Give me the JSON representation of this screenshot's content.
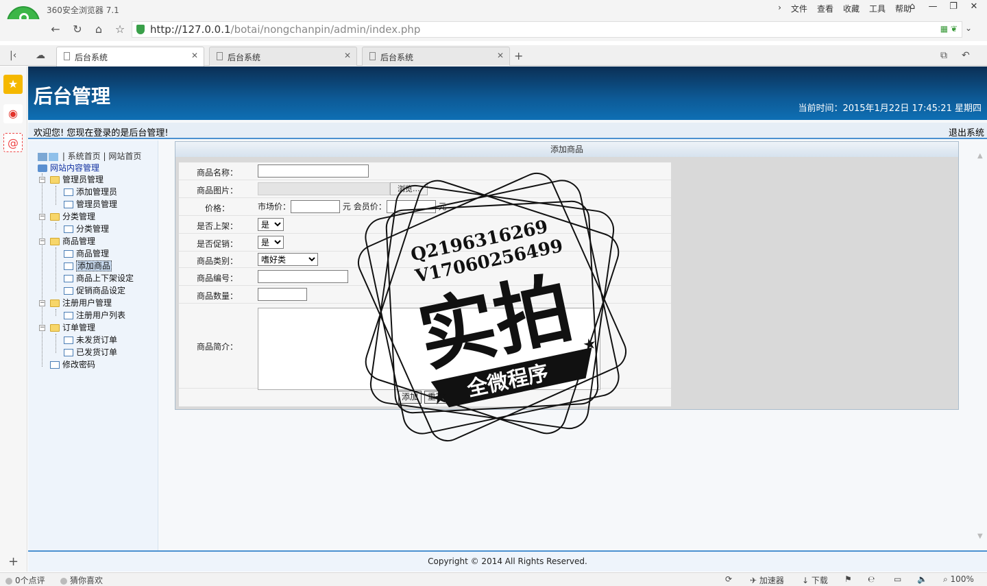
{
  "browser": {
    "app_title": "360安全浏览器 7.1",
    "menu": [
      "文件",
      "查看",
      "收藏",
      "工具",
      "帮助"
    ],
    "url_host": "http://127.0.0.1",
    "url_path": "/botai/nongchanpin/admin/index.php",
    "tabs": [
      {
        "label": "后台系统",
        "active": true
      },
      {
        "label": "后台系统",
        "active": false
      },
      {
        "label": "后台系统",
        "active": false
      }
    ],
    "status": {
      "comments": "0个点评",
      "guess": "猜你喜欢",
      "accelerator": "加速器",
      "download": "下载",
      "zoom": "100%"
    }
  },
  "header": {
    "title": "后台管理",
    "current_time": "当前时间：2015年1月22日 17:45:21 星期四",
    "welcome": "欢迎您! 您现在登录的是后台管理!",
    "logout": "退出系统"
  },
  "sidebar": {
    "top_links": "| 系统首页 | 网站首页",
    "root": "网站内容管理",
    "groups": [
      {
        "label": "管理员管理",
        "items": [
          "添加管理员",
          "管理员管理"
        ]
      },
      {
        "label": "分类管理",
        "items": [
          "分类管理"
        ]
      },
      {
        "label": "商品管理",
        "items": [
          "商品管理",
          "添加商品",
          "商品上下架设定",
          "促销商品设定"
        ]
      },
      {
        "label": "注册用户管理",
        "items": [
          "注册用户列表"
        ]
      },
      {
        "label": "订单管理",
        "items": [
          "未发货订单",
          "已发货订单"
        ]
      }
    ],
    "change_password": "修改密码",
    "selected": "添加商品"
  },
  "form": {
    "title": "添加商品",
    "name_label": "商品名称：",
    "image_label": "商品图片：",
    "browse_label": "浏览...",
    "price_label": "价格：",
    "market_price_label": "市场价：",
    "member_price_label": "会员价：",
    "yuan": "元",
    "on_shelf_label": "是否上架：",
    "on_shelf_value": "是",
    "promo_label": "是否促销：",
    "promo_value": "是",
    "category_label": "商品类别：",
    "category_value": "嗜好类",
    "code_label": "商品编号：",
    "quantity_label": "商品数量：",
    "desc_label": "商品简介：",
    "submit_label": "添加",
    "reset_label": "重写"
  },
  "footer": {
    "copyright": "Copyright © 2014 All Rights Reserved."
  },
  "watermark": {
    "line1": "Q2196316269",
    "line2": "V17060256499",
    "big": "实拍",
    "banner": "全微程序"
  }
}
